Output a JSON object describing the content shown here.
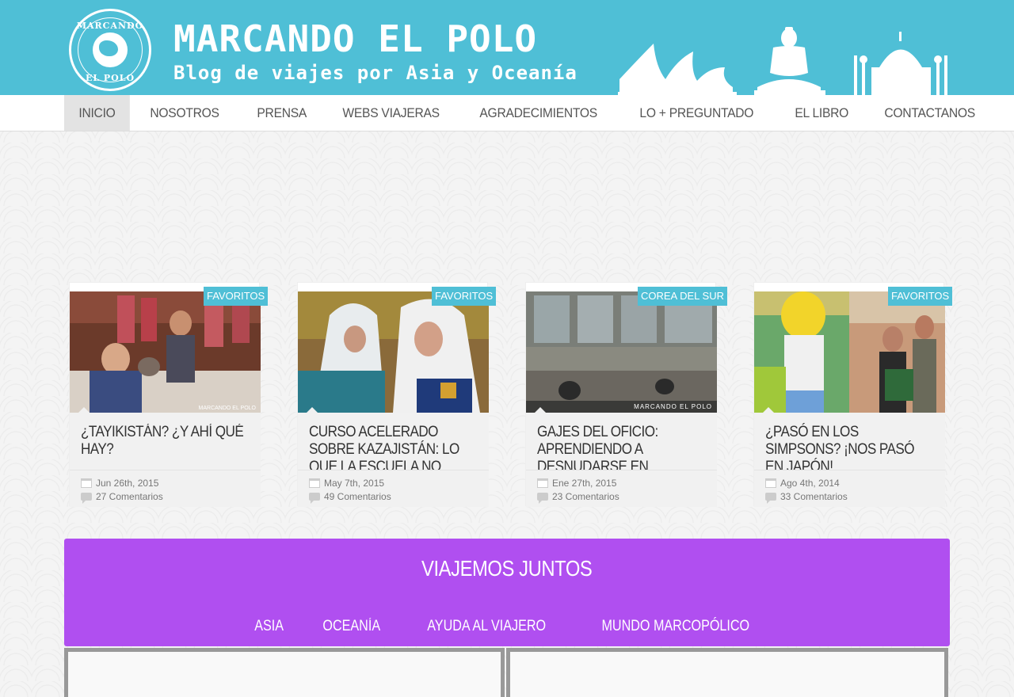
{
  "header": {
    "logo_text_top": "MARCANDO",
    "logo_text_bottom": "EL POLO",
    "title": "MARCANDO EL POLO",
    "subtitle": "Blog de viajes por Asia y Oceanía"
  },
  "nav": {
    "items": [
      {
        "label": "INICIO",
        "active": true
      },
      {
        "label": "NOSOTROS"
      },
      {
        "label": "PRENSA"
      },
      {
        "label": "WEBS VIAJERAS"
      },
      {
        "label": "AGRADECIMIENTOS"
      },
      {
        "label": "LO + PREGUNTADO"
      },
      {
        "label": "EL LIBRO"
      },
      {
        "label": "CONTACTANOS"
      }
    ]
  },
  "posts": [
    {
      "tag": "FAVORITOS",
      "title": "¿TAYIKISTÁN? ¿Y AHÍ QUÉ HAY?",
      "date": "Jun 26th, 2015",
      "comments": "27 Comentarios",
      "watermark": "MARCANDO EL POLO"
    },
    {
      "tag": "FAVORITOS",
      "title": "CURSO ACELERADO SOBRE KAZAJISTÁN: LO QUE LA ESCUELA NO",
      "date": "May 7th, 2015",
      "comments": "49 Comentarios"
    },
    {
      "tag": "COREA DEL SUR",
      "title": "GAJES DEL OFICIO: APRENDIENDO A DESNUDARSE EN PÚBLICO",
      "date": "Ene 27th, 2015",
      "comments": "23 Comentarios",
      "watermark": "MARCANDO EL POLO"
    },
    {
      "tag": "FAVORITOS",
      "title": "¿PASÓ EN LOS SIMPSONS? ¡NOS PASÓ EN JAPÓN!",
      "date": "Ago 4th, 2014",
      "comments": "33 Comentarios"
    }
  ],
  "travel": {
    "title": "VIAJEMOS JUNTOS",
    "tabs": [
      "ASIA",
      "OCEANÍA",
      "AYUDA AL VIAJERO",
      "MUNDO MARCOPÓLICO"
    ]
  },
  "colors": {
    "header_bg": "#4fbfd6",
    "tag_bg": "#4fbfd6",
    "travel_bg": "#b04ff0"
  }
}
